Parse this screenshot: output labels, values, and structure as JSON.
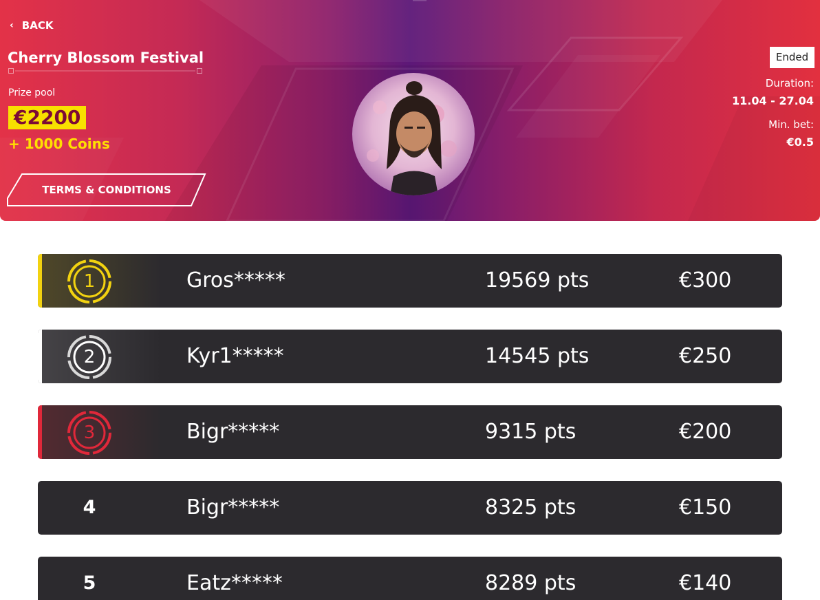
{
  "banner": {
    "back_label": "BACK",
    "title": "Cherry Blossom Festival",
    "prize_label": "Prize pool",
    "prize_amount": "€2200",
    "prize_extra": "+ 1000 Coins",
    "terms_label": "TERMS & CONDITIONS",
    "status": "Ended",
    "duration_label": "Duration:",
    "duration_value": "11.04 - 27.04",
    "min_bet_label": "Min. bet:",
    "min_bet_value": "€0.5"
  },
  "colors": {
    "gold": "#f2d210",
    "silver": "#d9d9d9",
    "bronze": "#e0283a",
    "row_bg": "#2c2a2e",
    "prize_highlight": "#f8e100"
  },
  "leaderboard": [
    {
      "rank": "1",
      "player": "Gros*****",
      "points": "19569 pts",
      "reward": "€300"
    },
    {
      "rank": "2",
      "player": "Kyr1*****",
      "points": "14545 pts",
      "reward": "€250"
    },
    {
      "rank": "3",
      "player": "Bigr*****",
      "points": "9315 pts",
      "reward": "€200"
    },
    {
      "rank": "4",
      "player": "Bigr*****",
      "points": "8325 pts",
      "reward": "€150"
    },
    {
      "rank": "5",
      "player": "Eatz*****",
      "points": "8289 pts",
      "reward": "€140"
    }
  ]
}
